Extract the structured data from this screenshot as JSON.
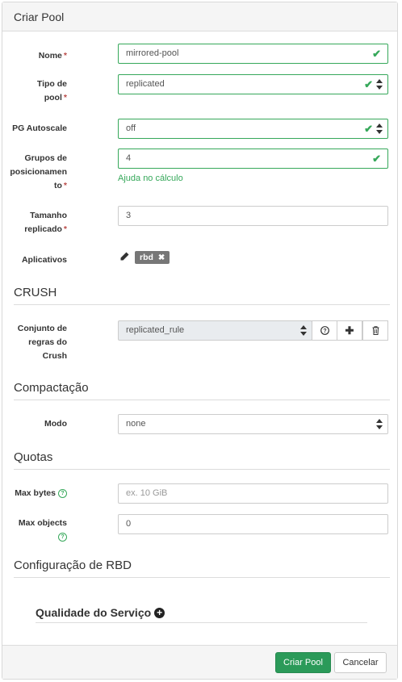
{
  "header": {
    "title": "Criar Pool"
  },
  "form": {
    "name": {
      "label": "Nome",
      "required": "*",
      "value": "mirrored-pool"
    },
    "pool_type": {
      "label_lines": [
        "Tipo de",
        "pool"
      ],
      "required": "*",
      "value": "replicated"
    },
    "pg_autoscale": {
      "label": "PG Autoscale",
      "value": "off"
    },
    "pg_num": {
      "label_lines": [
        "Grupos de",
        "posicionamen",
        "to"
      ],
      "required": "*",
      "value": "4",
      "help_link": "Ajuda no cálculo"
    },
    "size": {
      "label_lines": [
        "Tamanho",
        "replicado"
      ],
      "required": "*",
      "value": "3"
    },
    "applications": {
      "label": "Aplicativos",
      "tags": [
        "rbd"
      ]
    }
  },
  "crush": {
    "section_title": "CRUSH",
    "rule_set": {
      "label_lines": [
        "Conjunto de",
        "regras do",
        "Crush"
      ],
      "value": "replicated_rule"
    }
  },
  "compression": {
    "section_title": "Compactação",
    "mode": {
      "label": "Modo",
      "value": "none"
    }
  },
  "quotas": {
    "section_title": "Quotas",
    "max_bytes": {
      "label": "Max bytes",
      "placeholder": "ex. 10 GiB"
    },
    "max_objects": {
      "label": "Max objects",
      "value": "0"
    }
  },
  "rbd": {
    "section_title": "Configuração de RBD",
    "qos_title": "Qualidade do Serviço"
  },
  "footer": {
    "submit_label": "Criar Pool",
    "cancel_label": "Cancelar"
  },
  "colors": {
    "valid": "#36a85a",
    "primary": "#2b9a59",
    "required": "#b94a48",
    "badge": "#777777"
  },
  "icons": [
    "check-icon",
    "sort-icon",
    "pencil-icon",
    "close-icon",
    "question-icon",
    "plus-icon",
    "trash-icon",
    "plus-circle-icon"
  ]
}
